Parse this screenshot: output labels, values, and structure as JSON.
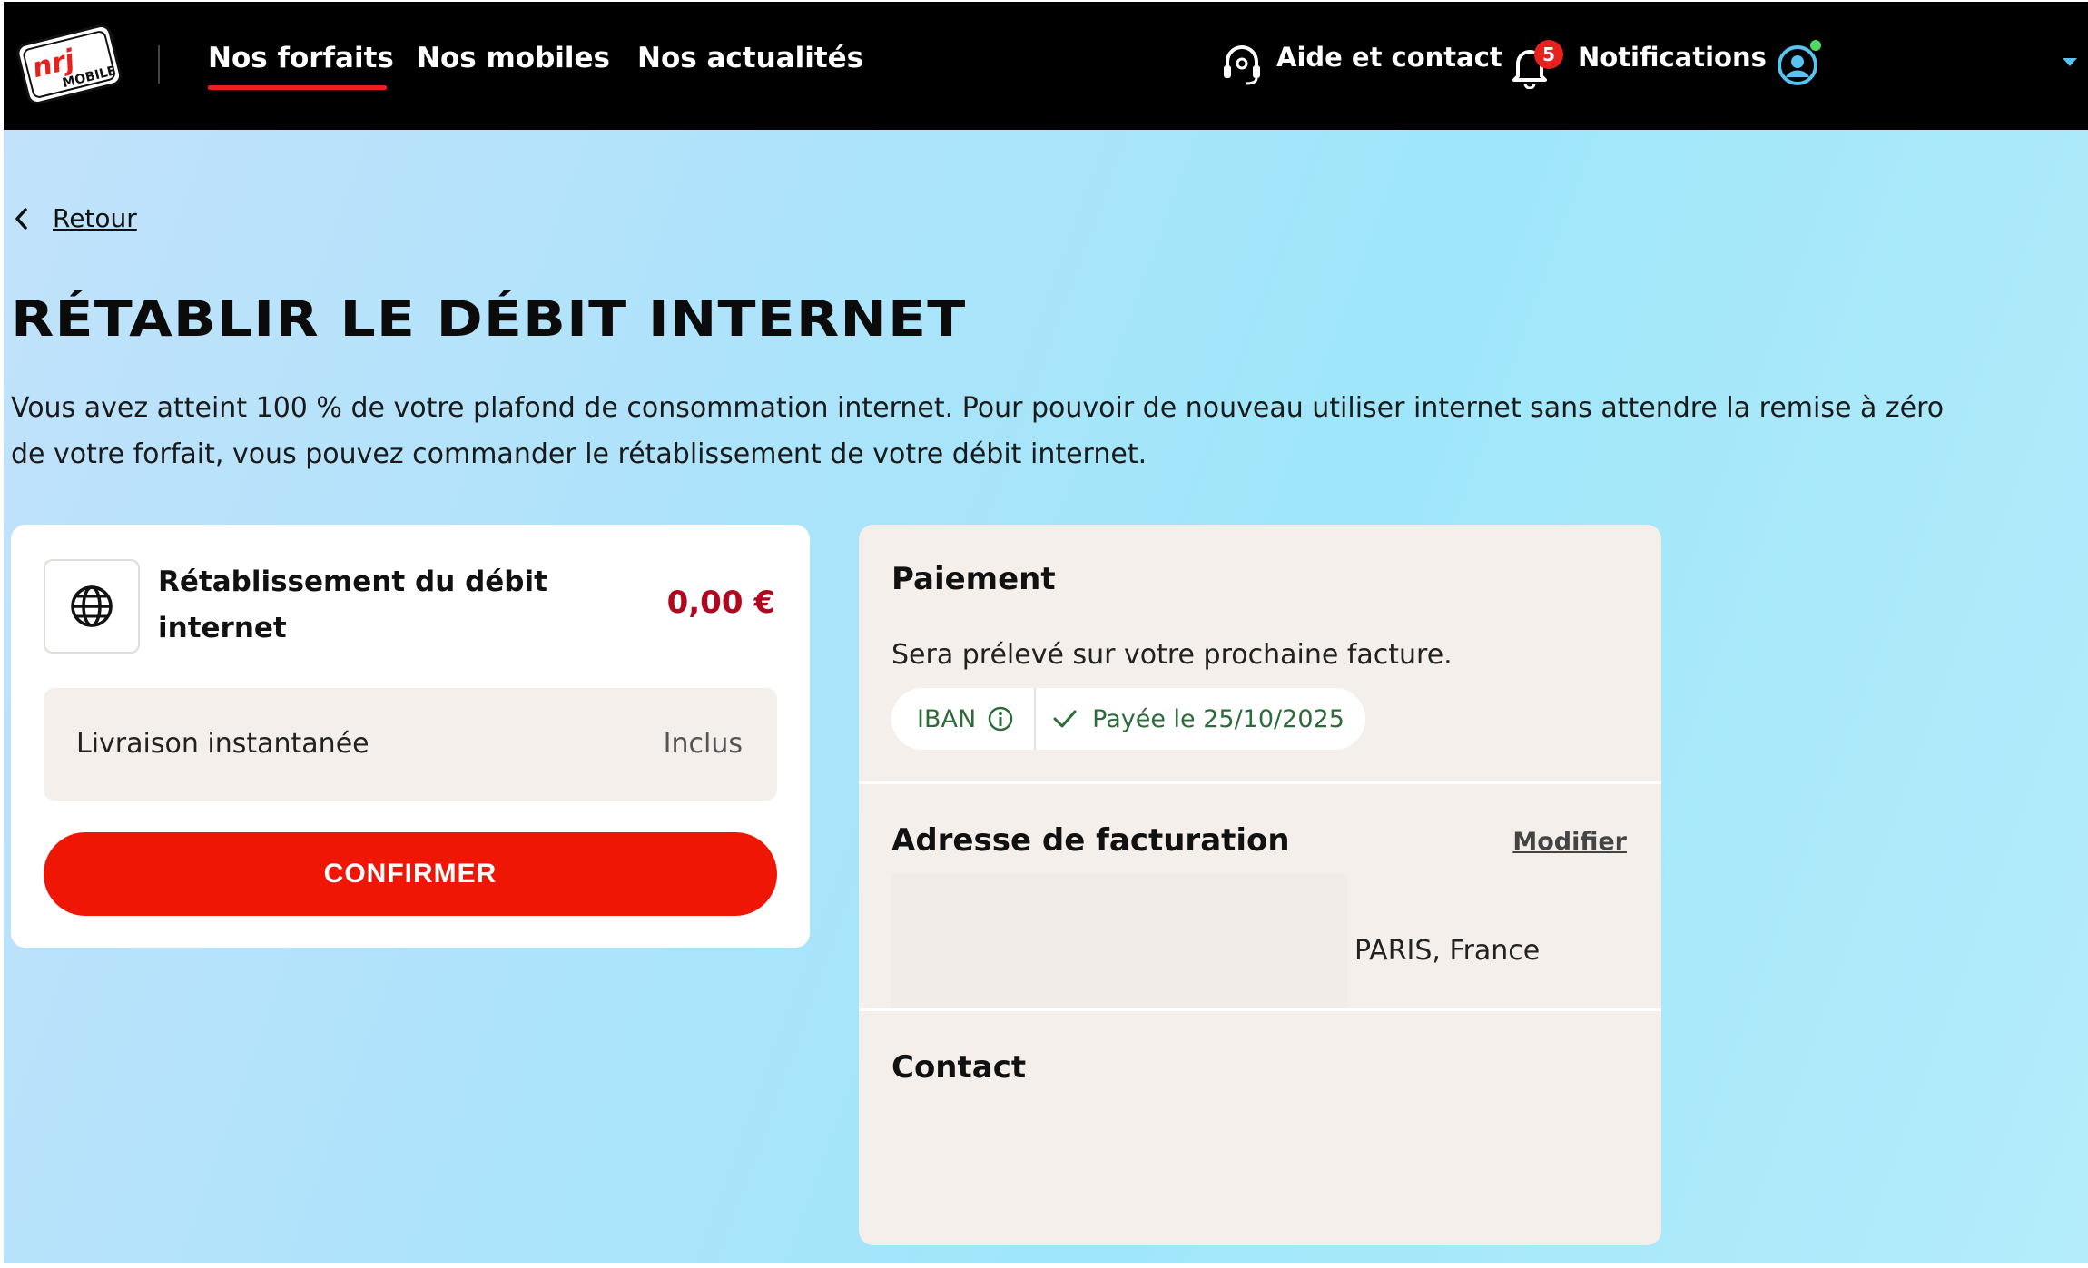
{
  "header": {
    "logo_text": "nrj MOBILE",
    "nav": [
      "Nos forfaits",
      "Nos mobiles",
      "Nos actualités"
    ],
    "active_nav": "Nos forfaits",
    "help_label": "Aide et contact",
    "notifications_label": "Notifications",
    "notifications_count": "5",
    "accent_color": "#e8211c"
  },
  "back": {
    "label": "Retour"
  },
  "page": {
    "title": "RÉTABLIR LE DÉBIT INTERNET",
    "intro_line1": "Vous avez atteint 100 % de votre plafond de consommation internet. Pour pouvoir de nouveau utiliser internet sans attendre la remise à zéro",
    "intro_line2": "de votre forfait, vous pouvez commander le rétablissement de votre débit internet."
  },
  "order": {
    "product_icon": "globe-icon",
    "product_name_line1": "Rétablissement du débit",
    "product_name_line2": "internet",
    "price": "0,00 €",
    "price_color": "#b0081f",
    "delivery_label": "Livraison instantanée",
    "delivery_value": "Inclus",
    "confirm_label": "CONFIRMER",
    "confirm_color": "#f01606"
  },
  "payment": {
    "title": "Paiement",
    "text": "Sera prélevé sur votre prochaine facture.",
    "method": "IBAN",
    "status": "Payée le 25/10/2025",
    "status_color": "#2e6b3a"
  },
  "billing": {
    "title": "Adresse de facturation",
    "modify_label": "Modifier",
    "city": "PARIS, France"
  },
  "contact": {
    "title": "Contact"
  }
}
